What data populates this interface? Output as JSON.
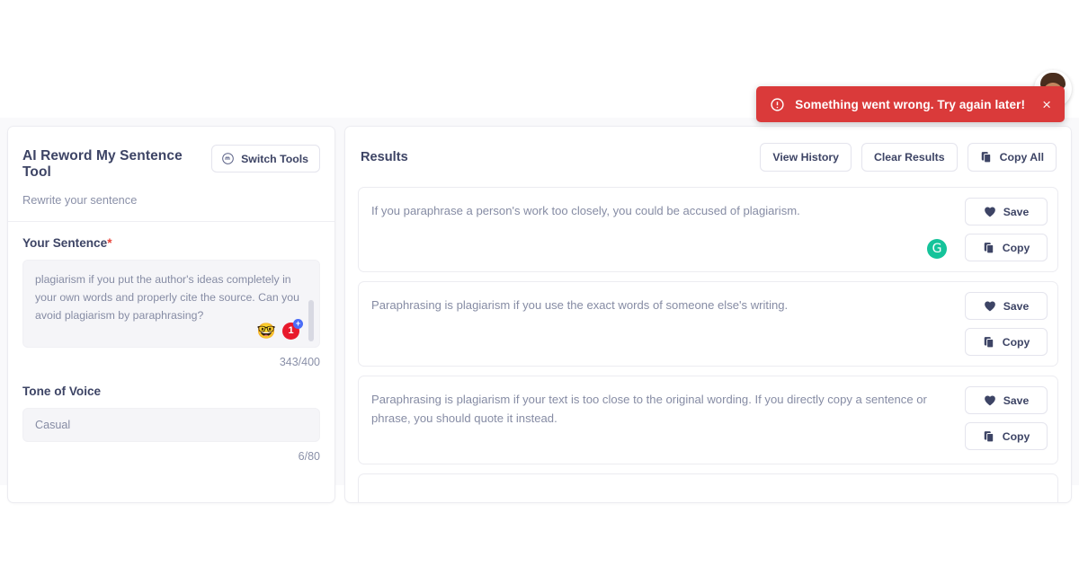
{
  "toast": {
    "message": "Something went wrong. Try again later!",
    "close_label": "×",
    "icon": "alert-circle-icon",
    "background": "#da3a3a",
    "text_color": "#ffffff"
  },
  "avatar": {
    "name": "user-avatar"
  },
  "left_panel": {
    "title": "AI Reword My Sentence Tool",
    "subtitle": "Rewrite your sentence",
    "switch_tools": {
      "label": "Switch Tools",
      "icon": "switch-tools-icon"
    },
    "sentence_field": {
      "label": "Your Sentence",
      "required_marker": "*",
      "value": "plagiarism if you put the author's ideas completely in your own words and properly cite the source. Can you avoid plagiarism by paraphrasing?",
      "counter": "343/400",
      "badges": {
        "emoji": "🤓",
        "count": "1",
        "plus": "+"
      }
    },
    "tone_field": {
      "label": "Tone of Voice",
      "value": "Casual",
      "counter": "6/80"
    }
  },
  "right_panel": {
    "title": "Results",
    "actions": [
      {
        "label": "View History",
        "icon": null
      },
      {
        "label": "Clear Results",
        "icon": null
      },
      {
        "label": "Copy All",
        "icon": "copy-icon"
      }
    ],
    "save_label": "Save",
    "copy_label": "Copy",
    "save_icon": "heart-icon",
    "copy_icon": "copy-icon",
    "grammarly_icon": "grammarly-icon",
    "grammarly_glyph": "G",
    "grammarly_color": "#15c39a",
    "results": [
      {
        "text": "If you paraphrase a person's work too closely, you could be accused of plagiarism.",
        "has_grammarly": true
      },
      {
        "text": "Paraphrasing is plagiarism if you use the exact words of someone else's writing.",
        "has_grammarly": false
      },
      {
        "text": "Paraphrasing is plagiarism if your text is too close to the original wording. If you directly copy a sentence or phrase, you should quote it instead.",
        "has_grammarly": false
      }
    ]
  }
}
